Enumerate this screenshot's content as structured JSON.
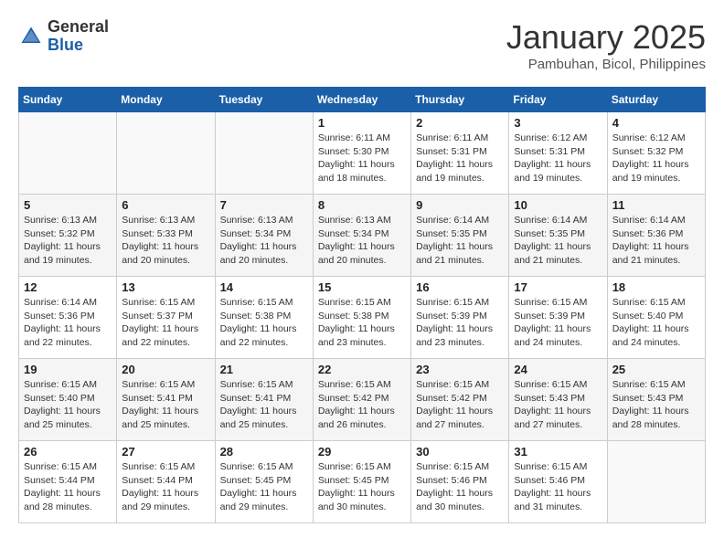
{
  "logo": {
    "general": "General",
    "blue": "Blue"
  },
  "title": "January 2025",
  "subtitle": "Pambuhan, Bicol, Philippines",
  "days_of_week": [
    "Sunday",
    "Monday",
    "Tuesday",
    "Wednesday",
    "Thursday",
    "Friday",
    "Saturday"
  ],
  "weeks": [
    [
      {
        "day": "",
        "sunrise": "",
        "sunset": "",
        "daylight": ""
      },
      {
        "day": "",
        "sunrise": "",
        "sunset": "",
        "daylight": ""
      },
      {
        "day": "",
        "sunrise": "",
        "sunset": "",
        "daylight": ""
      },
      {
        "day": "1",
        "sunrise": "Sunrise: 6:11 AM",
        "sunset": "Sunset: 5:30 PM",
        "daylight": "Daylight: 11 hours and 18 minutes."
      },
      {
        "day": "2",
        "sunrise": "Sunrise: 6:11 AM",
        "sunset": "Sunset: 5:31 PM",
        "daylight": "Daylight: 11 hours and 19 minutes."
      },
      {
        "day": "3",
        "sunrise": "Sunrise: 6:12 AM",
        "sunset": "Sunset: 5:31 PM",
        "daylight": "Daylight: 11 hours and 19 minutes."
      },
      {
        "day": "4",
        "sunrise": "Sunrise: 6:12 AM",
        "sunset": "Sunset: 5:32 PM",
        "daylight": "Daylight: 11 hours and 19 minutes."
      }
    ],
    [
      {
        "day": "5",
        "sunrise": "Sunrise: 6:13 AM",
        "sunset": "Sunset: 5:32 PM",
        "daylight": "Daylight: 11 hours and 19 minutes."
      },
      {
        "day": "6",
        "sunrise": "Sunrise: 6:13 AM",
        "sunset": "Sunset: 5:33 PM",
        "daylight": "Daylight: 11 hours and 20 minutes."
      },
      {
        "day": "7",
        "sunrise": "Sunrise: 6:13 AM",
        "sunset": "Sunset: 5:34 PM",
        "daylight": "Daylight: 11 hours and 20 minutes."
      },
      {
        "day": "8",
        "sunrise": "Sunrise: 6:13 AM",
        "sunset": "Sunset: 5:34 PM",
        "daylight": "Daylight: 11 hours and 20 minutes."
      },
      {
        "day": "9",
        "sunrise": "Sunrise: 6:14 AM",
        "sunset": "Sunset: 5:35 PM",
        "daylight": "Daylight: 11 hours and 21 minutes."
      },
      {
        "day": "10",
        "sunrise": "Sunrise: 6:14 AM",
        "sunset": "Sunset: 5:35 PM",
        "daylight": "Daylight: 11 hours and 21 minutes."
      },
      {
        "day": "11",
        "sunrise": "Sunrise: 6:14 AM",
        "sunset": "Sunset: 5:36 PM",
        "daylight": "Daylight: 11 hours and 21 minutes."
      }
    ],
    [
      {
        "day": "12",
        "sunrise": "Sunrise: 6:14 AM",
        "sunset": "Sunset: 5:36 PM",
        "daylight": "Daylight: 11 hours and 22 minutes."
      },
      {
        "day": "13",
        "sunrise": "Sunrise: 6:15 AM",
        "sunset": "Sunset: 5:37 PM",
        "daylight": "Daylight: 11 hours and 22 minutes."
      },
      {
        "day": "14",
        "sunrise": "Sunrise: 6:15 AM",
        "sunset": "Sunset: 5:38 PM",
        "daylight": "Daylight: 11 hours and 22 minutes."
      },
      {
        "day": "15",
        "sunrise": "Sunrise: 6:15 AM",
        "sunset": "Sunset: 5:38 PM",
        "daylight": "Daylight: 11 hours and 23 minutes."
      },
      {
        "day": "16",
        "sunrise": "Sunrise: 6:15 AM",
        "sunset": "Sunset: 5:39 PM",
        "daylight": "Daylight: 11 hours and 23 minutes."
      },
      {
        "day": "17",
        "sunrise": "Sunrise: 6:15 AM",
        "sunset": "Sunset: 5:39 PM",
        "daylight": "Daylight: 11 hours and 24 minutes."
      },
      {
        "day": "18",
        "sunrise": "Sunrise: 6:15 AM",
        "sunset": "Sunset: 5:40 PM",
        "daylight": "Daylight: 11 hours and 24 minutes."
      }
    ],
    [
      {
        "day": "19",
        "sunrise": "Sunrise: 6:15 AM",
        "sunset": "Sunset: 5:40 PM",
        "daylight": "Daylight: 11 hours and 25 minutes."
      },
      {
        "day": "20",
        "sunrise": "Sunrise: 6:15 AM",
        "sunset": "Sunset: 5:41 PM",
        "daylight": "Daylight: 11 hours and 25 minutes."
      },
      {
        "day": "21",
        "sunrise": "Sunrise: 6:15 AM",
        "sunset": "Sunset: 5:41 PM",
        "daylight": "Daylight: 11 hours and 25 minutes."
      },
      {
        "day": "22",
        "sunrise": "Sunrise: 6:15 AM",
        "sunset": "Sunset: 5:42 PM",
        "daylight": "Daylight: 11 hours and 26 minutes."
      },
      {
        "day": "23",
        "sunrise": "Sunrise: 6:15 AM",
        "sunset": "Sunset: 5:42 PM",
        "daylight": "Daylight: 11 hours and 27 minutes."
      },
      {
        "day": "24",
        "sunrise": "Sunrise: 6:15 AM",
        "sunset": "Sunset: 5:43 PM",
        "daylight": "Daylight: 11 hours and 27 minutes."
      },
      {
        "day": "25",
        "sunrise": "Sunrise: 6:15 AM",
        "sunset": "Sunset: 5:43 PM",
        "daylight": "Daylight: 11 hours and 28 minutes."
      }
    ],
    [
      {
        "day": "26",
        "sunrise": "Sunrise: 6:15 AM",
        "sunset": "Sunset: 5:44 PM",
        "daylight": "Daylight: 11 hours and 28 minutes."
      },
      {
        "day": "27",
        "sunrise": "Sunrise: 6:15 AM",
        "sunset": "Sunset: 5:44 PM",
        "daylight": "Daylight: 11 hours and 29 minutes."
      },
      {
        "day": "28",
        "sunrise": "Sunrise: 6:15 AM",
        "sunset": "Sunset: 5:45 PM",
        "daylight": "Daylight: 11 hours and 29 minutes."
      },
      {
        "day": "29",
        "sunrise": "Sunrise: 6:15 AM",
        "sunset": "Sunset: 5:45 PM",
        "daylight": "Daylight: 11 hours and 30 minutes."
      },
      {
        "day": "30",
        "sunrise": "Sunrise: 6:15 AM",
        "sunset": "Sunset: 5:46 PM",
        "daylight": "Daylight: 11 hours and 30 minutes."
      },
      {
        "day": "31",
        "sunrise": "Sunrise: 6:15 AM",
        "sunset": "Sunset: 5:46 PM",
        "daylight": "Daylight: 11 hours and 31 minutes."
      },
      {
        "day": "",
        "sunrise": "",
        "sunset": "",
        "daylight": ""
      }
    ]
  ]
}
